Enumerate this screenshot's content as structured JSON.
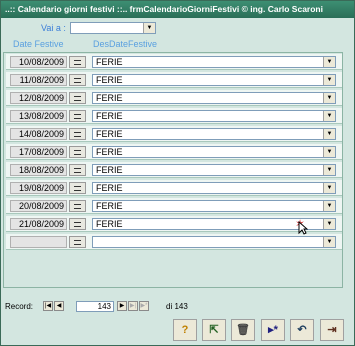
{
  "window": {
    "title": "..:: Calendario giorni festivi ::..   frmCalendarioGiorniFestivi © ing. Carlo Scaroni"
  },
  "filter": {
    "label": "Vai a :",
    "value": ""
  },
  "columns": {
    "date": "Date Festive",
    "desc": "DesDateFestive"
  },
  "rows": [
    {
      "date": "10/08/2009",
      "desc": "FERIE"
    },
    {
      "date": "11/08/2009",
      "desc": "FERIE"
    },
    {
      "date": "12/08/2009",
      "desc": "FERIE"
    },
    {
      "date": "13/08/2009",
      "desc": "FERIE"
    },
    {
      "date": "14/08/2009",
      "desc": "FERIE"
    },
    {
      "date": "17/08/2009",
      "desc": "FERIE"
    },
    {
      "date": "18/08/2009",
      "desc": "FERIE"
    },
    {
      "date": "19/08/2009",
      "desc": "FERIE"
    },
    {
      "date": "20/08/2009",
      "desc": "FERIE"
    },
    {
      "date": "21/08/2009",
      "desc": "FERIE"
    },
    {
      "date": "",
      "desc": ""
    }
  ],
  "navigator": {
    "label": "Record:",
    "current": "143",
    "of_label": "di",
    "total": "143"
  },
  "toolbar_icons": [
    "help-icon",
    "search-record-icon",
    "delete-icon",
    "new-record-icon",
    "undo-icon",
    "exit-icon"
  ],
  "colors": {
    "title_bar": "#2a6e57",
    "background": "#d3e6e0",
    "header_text": "#5aa0e0"
  }
}
